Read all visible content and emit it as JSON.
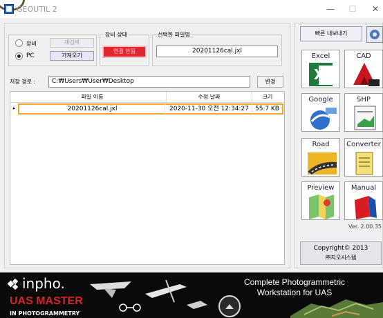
{
  "window": {
    "title": "GEOUTIL 2",
    "min": "—",
    "max": "☐",
    "close": "✕"
  },
  "source": {
    "equipment_label": "장비",
    "pc_label": "PC",
    "rescan_button": "재검색",
    "load_button": "가져오기",
    "selected": "PC"
  },
  "device_status": {
    "legend": "장비 상태",
    "status_text": "연결 안됨",
    "status_color": "#e0262e"
  },
  "selected_file": {
    "legend": "선택한 파일명",
    "value": "20201126cal.jxl"
  },
  "save_path": {
    "label": "저장 경로 :",
    "value": "C:₩Users₩User₩Desktop",
    "change_button": "변경"
  },
  "file_table": {
    "headers": [
      "파일 이름",
      "수정 날짜",
      "크기"
    ],
    "rows": [
      {
        "name": "20201126cal.jxl",
        "modified": "2020-11-30 오전 12:34:27",
        "size": "55.7 KB"
      }
    ]
  },
  "right_panel": {
    "quick_export_button": "빠른 내보내기",
    "tiles": [
      {
        "label": "Excel",
        "icon": "excel-icon"
      },
      {
        "label": "CAD",
        "icon": "autocad-icon"
      },
      {
        "label": "Google",
        "icon": "google-earth-kml-icon"
      },
      {
        "label": "SHP",
        "icon": "shapefile-icon"
      },
      {
        "label": "Road",
        "icon": "road-icon"
      },
      {
        "label": "Converter",
        "icon": "converter-document-icon"
      },
      {
        "label": "Preview",
        "icon": "map-preview-icon"
      },
      {
        "label": "Manual",
        "icon": "manual-book-icon"
      }
    ],
    "version": "Ver. 2.00.35",
    "copyright_line1": "Copyright© 2013",
    "copyright_line2": "㈜지오시스템"
  },
  "banner": {
    "brand": "inpho.",
    "product": "UAS MASTER",
    "tagline": "IN PHOTOGRAMMETRY",
    "headline_line1": "Complete Photogrammetric",
    "headline_line2": "Workstation for UAS"
  }
}
